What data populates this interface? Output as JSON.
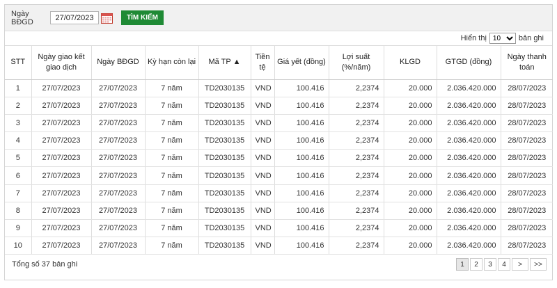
{
  "search": {
    "date_label": "Ngày BĐGD",
    "date_value": "27/07/2023",
    "button_label": "TÌM KIẾM"
  },
  "page_size": {
    "prefix": "Hiển thị",
    "selected": "10",
    "suffix": "bản ghi"
  },
  "table": {
    "headers": [
      "STT",
      "Ngày giao kết giao dịch",
      "Ngày BĐGD",
      "Kỳ hạn còn lại",
      "Mã TP ▲",
      "Tiền tệ",
      "Giá yết (đồng)",
      "Lợi suất (%/năm)",
      "KLGD",
      "GTGD (đồng)",
      "Ngày thanh toán"
    ],
    "rows": [
      [
        "1",
        "27/07/2023",
        "27/07/2023",
        "7 năm",
        "TD2030135",
        "VND",
        "100.416",
        "2,2374",
        "20.000",
        "2.036.420.000",
        "28/07/2023"
      ],
      [
        "2",
        "27/07/2023",
        "27/07/2023",
        "7 năm",
        "TD2030135",
        "VND",
        "100.416",
        "2,2374",
        "20.000",
        "2.036.420.000",
        "28/07/2023"
      ],
      [
        "3",
        "27/07/2023",
        "27/07/2023",
        "7 năm",
        "TD2030135",
        "VND",
        "100.416",
        "2,2374",
        "20.000",
        "2.036.420.000",
        "28/07/2023"
      ],
      [
        "4",
        "27/07/2023",
        "27/07/2023",
        "7 năm",
        "TD2030135",
        "VND",
        "100.416",
        "2,2374",
        "20.000",
        "2.036.420.000",
        "28/07/2023"
      ],
      [
        "5",
        "27/07/2023",
        "27/07/2023",
        "7 năm",
        "TD2030135",
        "VND",
        "100.416",
        "2,2374",
        "20.000",
        "2.036.420.000",
        "28/07/2023"
      ],
      [
        "6",
        "27/07/2023",
        "27/07/2023",
        "7 năm",
        "TD2030135",
        "VND",
        "100.416",
        "2,2374",
        "20.000",
        "2.036.420.000",
        "28/07/2023"
      ],
      [
        "7",
        "27/07/2023",
        "27/07/2023",
        "7 năm",
        "TD2030135",
        "VND",
        "100.416",
        "2,2374",
        "20.000",
        "2.036.420.000",
        "28/07/2023"
      ],
      [
        "8",
        "27/07/2023",
        "27/07/2023",
        "7 năm",
        "TD2030135",
        "VND",
        "100.416",
        "2,2374",
        "20.000",
        "2.036.420.000",
        "28/07/2023"
      ],
      [
        "9",
        "27/07/2023",
        "27/07/2023",
        "7 năm",
        "TD2030135",
        "VND",
        "100.416",
        "2,2374",
        "20.000",
        "2.036.420.000",
        "28/07/2023"
      ],
      [
        "10",
        "27/07/2023",
        "27/07/2023",
        "7 năm",
        "TD2030135",
        "VND",
        "100.416",
        "2,2374",
        "20.000",
        "2.036.420.000",
        "28/07/2023"
      ]
    ]
  },
  "footer": {
    "total_text": "Tổng số 37 bản ghi",
    "pages": [
      "1",
      "2",
      "3",
      "4"
    ],
    "current_page": "1",
    "next_label": ">",
    "last_label": ">>"
  },
  "colors": {
    "accent_green": "#1f8a35",
    "header_bg": "#f1f1f1"
  },
  "icons": {
    "date_picker": "calendar-icon"
  }
}
